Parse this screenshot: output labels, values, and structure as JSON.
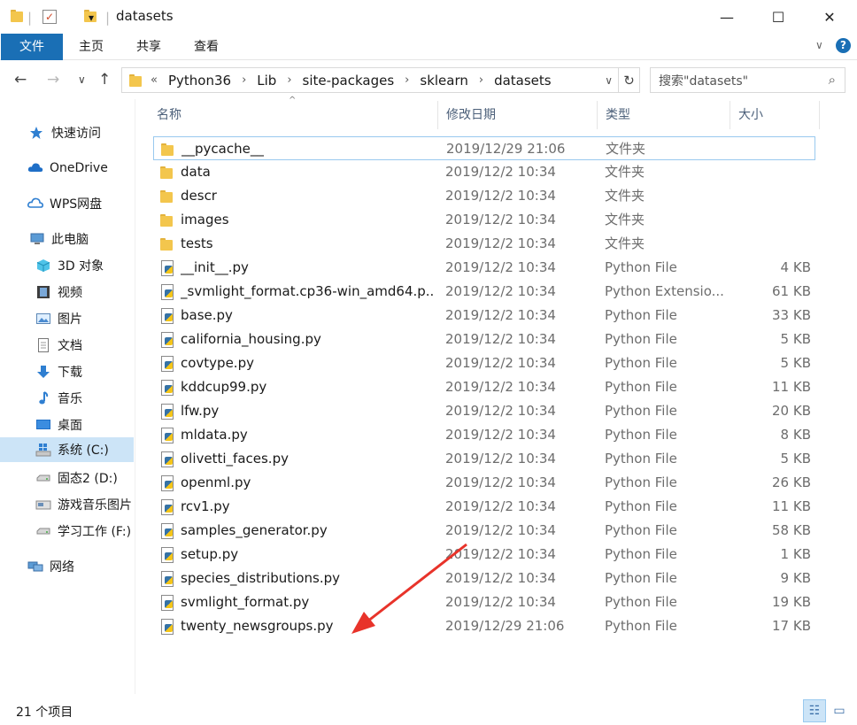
{
  "window": {
    "title": "datasets",
    "minimize_glyph": "—",
    "maximize_glyph": "☐",
    "close_glyph": "✕",
    "qa_dropdown_glyph": "▾",
    "qa_separator": "|"
  },
  "ribbon": {
    "tabs": [
      "文件",
      "主页",
      "共享",
      "查看"
    ],
    "expand_glyph": "∨",
    "help_glyph": "?"
  },
  "address": {
    "overflow_glyph": "«",
    "segments": [
      "Python36",
      "Lib",
      "site-packages",
      "sklearn",
      "datasets"
    ],
    "separator": "›",
    "dropdown_glyph": "∨",
    "refresh_glyph": "↻",
    "search_placeholder": "搜索\"datasets\"",
    "search_glyph": "⌕",
    "back_glyph": "←",
    "forward_glyph": "→",
    "recent_glyph": "∨",
    "up_glyph": "↑"
  },
  "sidebar": {
    "items": [
      {
        "label": "快速访问",
        "icon": "star-icon"
      },
      {
        "label": "OneDrive",
        "icon": "cloud-icon"
      },
      {
        "label": "WPS网盘",
        "icon": "cloud-outline-icon"
      },
      {
        "label": "此电脑",
        "icon": "computer-icon"
      },
      {
        "label": "3D 对象",
        "icon": "cube-icon"
      },
      {
        "label": "视频",
        "icon": "film-icon"
      },
      {
        "label": "图片",
        "icon": "picture-icon"
      },
      {
        "label": "文档",
        "icon": "document-icon"
      },
      {
        "label": "下载",
        "icon": "download-icon"
      },
      {
        "label": "音乐",
        "icon": "music-icon"
      },
      {
        "label": "桌面",
        "icon": "desktop-icon"
      },
      {
        "label": "系统 (C:)",
        "icon": "windows-drive-icon"
      },
      {
        "label": "固态2 (D:)",
        "icon": "drive-icon"
      },
      {
        "label": "游戏音乐图片",
        "icon": "drive-icon"
      },
      {
        "label": "学习工作 (F:)",
        "icon": "drive-icon"
      },
      {
        "label": "网络",
        "icon": "network-icon"
      }
    ],
    "selected": "系统 (C:)"
  },
  "columns": {
    "name": "名称",
    "date": "修改日期",
    "type": "类型",
    "size": "大小",
    "sort_glyph": "^"
  },
  "files": [
    {
      "name": "__pycache__",
      "date": "2019/12/29 21:06",
      "type": "文件夹",
      "size": "",
      "kind": "folder"
    },
    {
      "name": "data",
      "date": "2019/12/2 10:34",
      "type": "文件夹",
      "size": "",
      "kind": "folder"
    },
    {
      "name": "descr",
      "date": "2019/12/2 10:34",
      "type": "文件夹",
      "size": "",
      "kind": "folder"
    },
    {
      "name": "images",
      "date": "2019/12/2 10:34",
      "type": "文件夹",
      "size": "",
      "kind": "folder"
    },
    {
      "name": "tests",
      "date": "2019/12/2 10:34",
      "type": "文件夹",
      "size": "",
      "kind": "folder"
    },
    {
      "name": "__init__.py",
      "date": "2019/12/2 10:34",
      "type": "Python File",
      "size": "4 KB",
      "kind": "python"
    },
    {
      "name": "_svmlight_format.cp36-win_amd64.p...",
      "date": "2019/12/2 10:34",
      "type": "Python Extensio...",
      "size": "61 KB",
      "kind": "python"
    },
    {
      "name": "base.py",
      "date": "2019/12/2 10:34",
      "type": "Python File",
      "size": "33 KB",
      "kind": "python"
    },
    {
      "name": "california_housing.py",
      "date": "2019/12/2 10:34",
      "type": "Python File",
      "size": "5 KB",
      "kind": "python"
    },
    {
      "name": "covtype.py",
      "date": "2019/12/2 10:34",
      "type": "Python File",
      "size": "5 KB",
      "kind": "python"
    },
    {
      "name": "kddcup99.py",
      "date": "2019/12/2 10:34",
      "type": "Python File",
      "size": "11 KB",
      "kind": "python"
    },
    {
      "name": "lfw.py",
      "date": "2019/12/2 10:34",
      "type": "Python File",
      "size": "20 KB",
      "kind": "python"
    },
    {
      "name": "mldata.py",
      "date": "2019/12/2 10:34",
      "type": "Python File",
      "size": "8 KB",
      "kind": "python"
    },
    {
      "name": "olivetti_faces.py",
      "date": "2019/12/2 10:34",
      "type": "Python File",
      "size": "5 KB",
      "kind": "python"
    },
    {
      "name": "openml.py",
      "date": "2019/12/2 10:34",
      "type": "Python File",
      "size": "26 KB",
      "kind": "python"
    },
    {
      "name": "rcv1.py",
      "date": "2019/12/2 10:34",
      "type": "Python File",
      "size": "11 KB",
      "kind": "python"
    },
    {
      "name": "samples_generator.py",
      "date": "2019/12/2 10:34",
      "type": "Python File",
      "size": "58 KB",
      "kind": "python"
    },
    {
      "name": "setup.py",
      "date": "2019/12/2 10:34",
      "type": "Python File",
      "size": "1 KB",
      "kind": "python"
    },
    {
      "name": "species_distributions.py",
      "date": "2019/12/2 10:34",
      "type": "Python File",
      "size": "9 KB",
      "kind": "python"
    },
    {
      "name": "svmlight_format.py",
      "date": "2019/12/2 10:34",
      "type": "Python File",
      "size": "19 KB",
      "kind": "python"
    },
    {
      "name": "twenty_newsgroups.py",
      "date": "2019/12/29 21:06",
      "type": "Python File",
      "size": "17 KB",
      "kind": "python"
    }
  ],
  "status": {
    "item_count": "21 个项目",
    "details_view_glyph": "☷",
    "large_icons_glyph": "▭"
  },
  "annotation": {
    "color": "#e8332a",
    "points_to": "twenty_newsgroups.py"
  }
}
